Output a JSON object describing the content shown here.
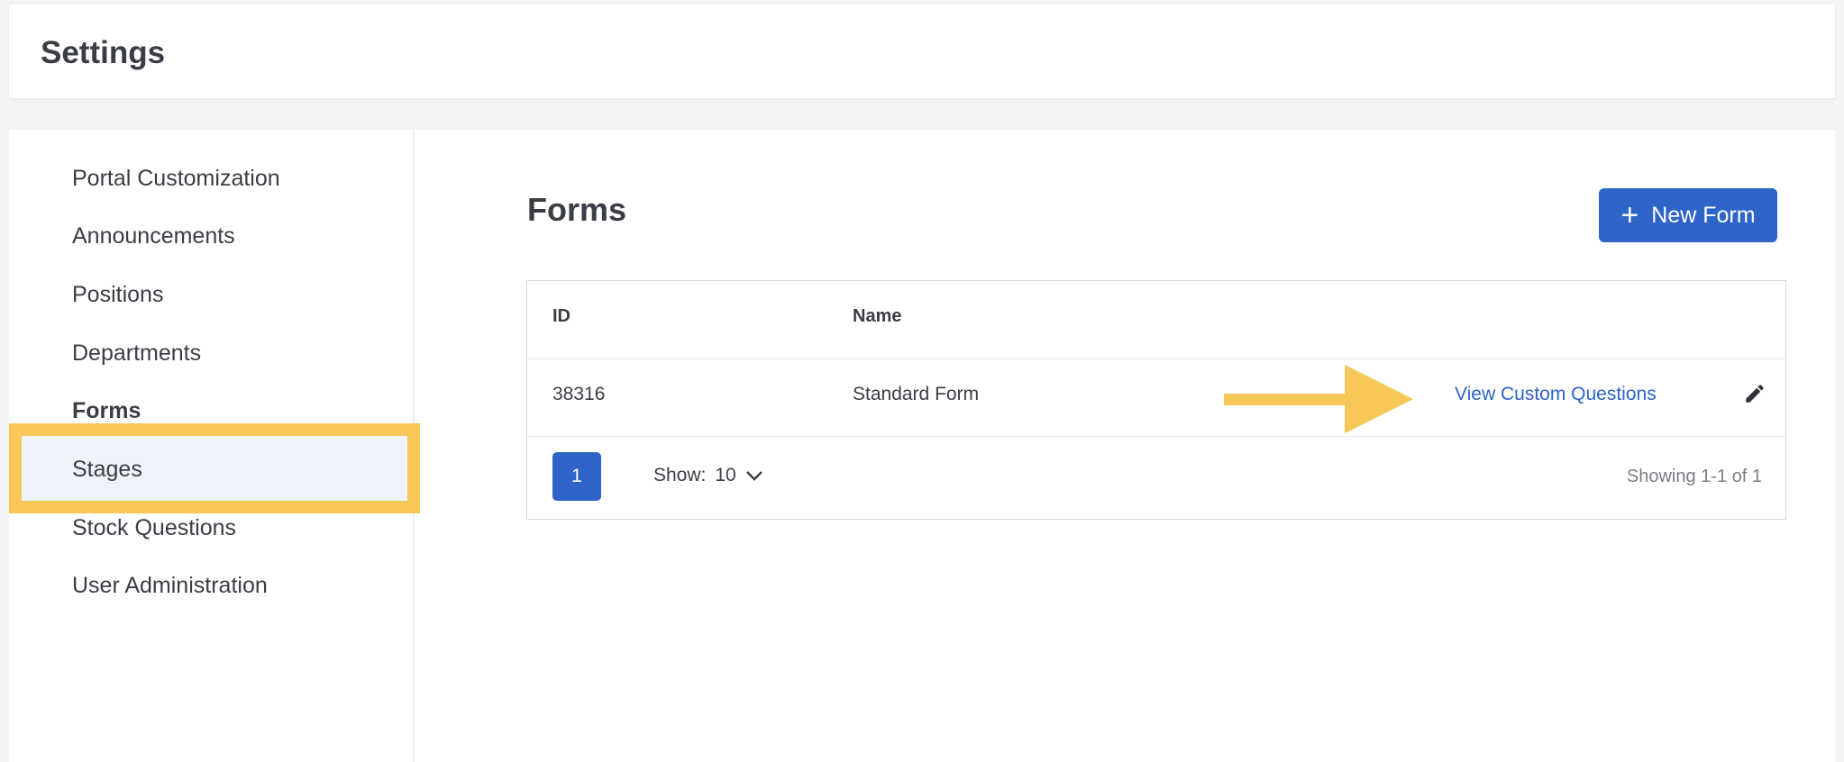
{
  "header": {
    "title": "Settings"
  },
  "sidebar": {
    "items": [
      {
        "label": "Portal Customization"
      },
      {
        "label": "Announcements"
      },
      {
        "label": "Positions"
      },
      {
        "label": "Departments"
      },
      {
        "label": "Forms"
      },
      {
        "label": "Stages"
      },
      {
        "label": "Stock Questions"
      },
      {
        "label": "User Administration"
      }
    ],
    "active": "Forms"
  },
  "main": {
    "title": "Forms",
    "new_button_label": "New Form",
    "table": {
      "columns": [
        "ID",
        "Name"
      ],
      "rows": [
        {
          "id": "38316",
          "name": "Standard Form",
          "link": "View Custom Questions"
        }
      ]
    },
    "pagination": {
      "current_page": "1",
      "show_label": "Show:",
      "show_value": "10",
      "showing_text": "Showing 1-1 of 1"
    }
  },
  "colors": {
    "primary": "#2e63c8",
    "highlight": "#f7c858",
    "active_bg": "#eff4fc"
  }
}
